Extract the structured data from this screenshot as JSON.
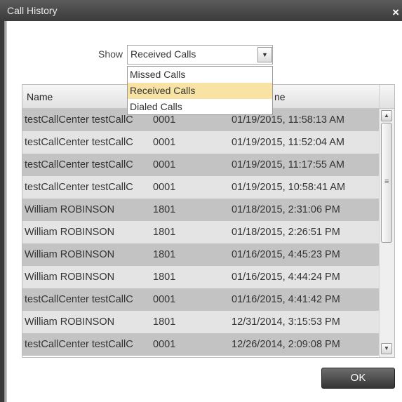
{
  "window": {
    "title": "Call History",
    "close_icon": "close-icon"
  },
  "filter": {
    "label": "Show",
    "selected": "Received Calls",
    "options": [
      "Missed Calls",
      "Received Calls",
      "Dialed Calls"
    ]
  },
  "table": {
    "columns": [
      "Name",
      "ne"
    ],
    "rows": [
      {
        "name": "testCallCenter testCallC",
        "number": "0001",
        "time": "01/19/2015, 11:58:13 AM"
      },
      {
        "name": "testCallCenter testCallC",
        "number": "0001",
        "time": "01/19/2015, 11:52:04 AM"
      },
      {
        "name": "testCallCenter testCallC",
        "number": "0001",
        "time": "01/19/2015, 11:17:55 AM"
      },
      {
        "name": "testCallCenter testCallC",
        "number": "0001",
        "time": "01/19/2015, 10:58:41 AM"
      },
      {
        "name": "William ROBINSON",
        "number": "1801",
        "time": "01/18/2015, 2:31:06 PM"
      },
      {
        "name": "William ROBINSON",
        "number": "1801",
        "time": "01/18/2015, 2:26:51 PM"
      },
      {
        "name": "William ROBINSON",
        "number": "1801",
        "time": "01/16/2015, 4:45:23 PM"
      },
      {
        "name": "William ROBINSON",
        "number": "1801",
        "time": "01/16/2015, 4:44:24 PM"
      },
      {
        "name": "testCallCenter testCallC",
        "number": "0001",
        "time": "01/16/2015, 4:41:42 PM"
      },
      {
        "name": "William ROBINSON",
        "number": "1801",
        "time": "12/31/2014, 3:15:53 PM"
      },
      {
        "name": "testCallCenter testCallC",
        "number": "0001",
        "time": "12/26/2014, 2:09:08 PM"
      }
    ]
  },
  "buttons": {
    "ok": "OK"
  },
  "colors": {
    "row_dark": "#c3c3c3",
    "row_light": "#e4e4e4",
    "highlight": "#f9e3a4",
    "titlebar": "#4a4a4a"
  }
}
